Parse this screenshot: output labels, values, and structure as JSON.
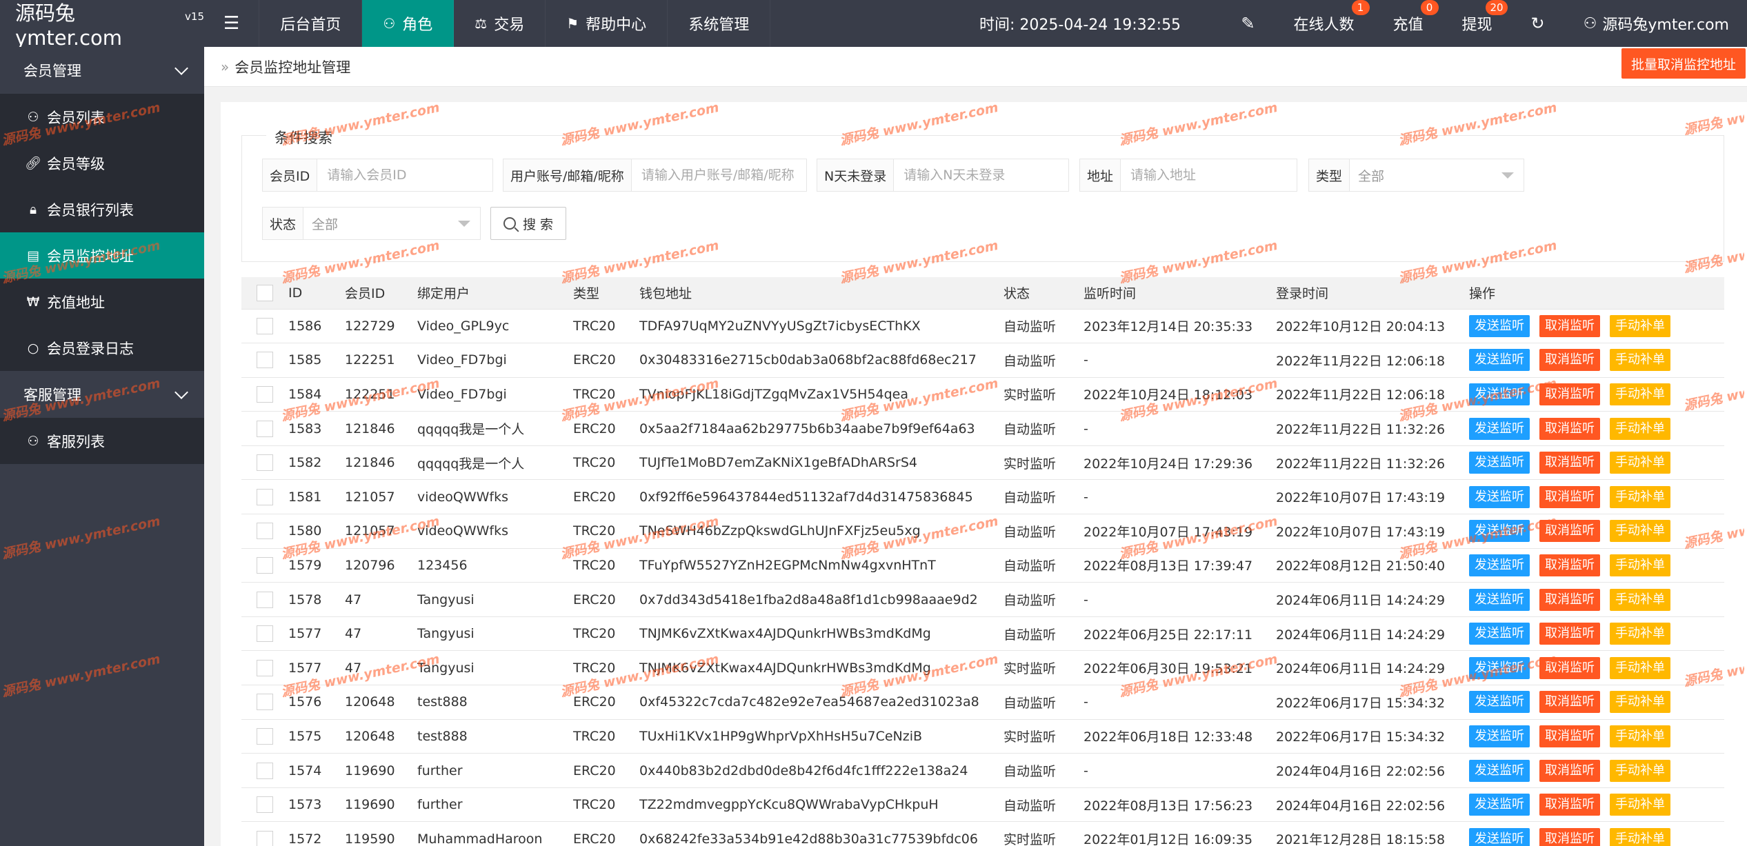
{
  "app": {
    "logo": "源码兔ymter.com",
    "version": "v15"
  },
  "topnav": {
    "items": [
      {
        "label": "后台首页"
      },
      {
        "label": "角色"
      },
      {
        "label": "交易"
      },
      {
        "label": "帮助中心"
      },
      {
        "label": "系统管理"
      }
    ],
    "time": "时间: 2025-04-24 19:32:55",
    "online": {
      "label": "在线人数",
      "badge": "1"
    },
    "recharge": {
      "label": "充值",
      "badge": "0"
    },
    "withdraw": {
      "label": "提现",
      "badge": "20"
    },
    "user": "源码兔ymter.com"
  },
  "sidebar": {
    "group1": "会员管理",
    "items1": [
      {
        "label": "会员列表"
      },
      {
        "label": "会员等级"
      },
      {
        "label": "会员银行列表"
      },
      {
        "label": "会员监控地址"
      },
      {
        "label": "充值地址"
      },
      {
        "label": "会员登录日志"
      }
    ],
    "group2": "客服管理",
    "items2": [
      {
        "label": "客服列表"
      }
    ]
  },
  "page": {
    "breadcrumb": "会员监控地址管理",
    "batch_button": "批量取消监控地址"
  },
  "search": {
    "legend": "条件搜索",
    "member_id_label": "会员ID",
    "member_id_placeholder": "请输入会员ID",
    "account_label": "用户账号/邮箱/昵称",
    "account_placeholder": "请输入用户账号/邮箱/昵称",
    "days_label": "N天未登录",
    "days_placeholder": "请输入N天未登录",
    "address_label": "地址",
    "address_placeholder": "请输入地址",
    "type_label": "类型",
    "type_value": "全部",
    "status_label": "状态",
    "status_value": "全部",
    "search_button": "搜 索"
  },
  "table": {
    "headers": [
      "ID",
      "会员ID",
      "绑定用户",
      "类型",
      "钱包地址",
      "状态",
      "监听时间",
      "登录时间",
      "操作"
    ],
    "actions": {
      "send": "发送监听",
      "cancel": "取消监听",
      "manual": "手动补单"
    },
    "rows": [
      {
        "id": "1586",
        "member_id": "122729",
        "user": "Video_GPL9yc",
        "type": "TRC20",
        "address": "TDFA97UqMY2uZNVYyUSgZt7icbysECThKX",
        "status": "自动监听",
        "status_kind": "green",
        "listen_time": "2023年12月14日 20:35:33",
        "login_time": "2022年10月12日 20:04:13"
      },
      {
        "id": "1585",
        "member_id": "122251",
        "user": "Video_FD7bgi",
        "type": "ERC20",
        "address": "0x30483316e2715cb0dab3a068bf2ac88fd68ec217",
        "status": "自动监听",
        "status_kind": "blue",
        "listen_time": "-",
        "login_time": "2022年11月22日 12:06:18"
      },
      {
        "id": "1584",
        "member_id": "122251",
        "user": "Video_FD7bgi",
        "type": "TRC20",
        "address": "TVniopFJKL18iGdjTZgqMvZax1V5H54qea",
        "status": "实时监听",
        "status_kind": "darkblue",
        "listen_time": "2022年10月24日 18:12:03",
        "login_time": "2022年11月22日 12:06:18"
      },
      {
        "id": "1583",
        "member_id": "121846",
        "user": "qqqqq我是一个人",
        "type": "ERC20",
        "address": "0x5aa2f7184aa62b29775b6b34aabe7b9f9ef64a63",
        "status": "自动监听",
        "status_kind": "blue",
        "listen_time": "-",
        "login_time": "2022年11月22日 11:32:26"
      },
      {
        "id": "1582",
        "member_id": "121846",
        "user": "qqqqq我是一个人",
        "type": "TRC20",
        "address": "TUJfTe1MoBD7emZaKNiX1geBfADhARSrS4",
        "status": "实时监听",
        "status_kind": "darkblue",
        "listen_time": "2022年10月24日 17:29:36",
        "login_time": "2022年11月22日 11:32:26"
      },
      {
        "id": "1581",
        "member_id": "121057",
        "user": "videoQWWfks",
        "type": "ERC20",
        "address": "0xf92ff6e596437844ed51132af7d4d31475836845",
        "status": "自动监听",
        "status_kind": "blue",
        "listen_time": "-",
        "login_time": "2022年10月07日 17:43:19"
      },
      {
        "id": "1580",
        "member_id": "121057",
        "user": "videoQWWfks",
        "type": "TRC20",
        "address": "TNeSWH46bZzpQkswdGLhUJnFXFjz5eu5xg",
        "status": "自动监听",
        "status_kind": "green",
        "listen_time": "2022年10月07日 17:43:19",
        "login_time": "2022年10月07日 17:43:19"
      },
      {
        "id": "1579",
        "member_id": "120796",
        "user": "123456",
        "type": "TRC20",
        "address": "TFuYpfW5527YZnH2EGPMcNmNw4gxvnHTnT",
        "status": "自动监听",
        "status_kind": "green",
        "listen_time": "2022年08月13日 17:39:47",
        "login_time": "2022年08月12日 21:50:40"
      },
      {
        "id": "1578",
        "member_id": "47",
        "user": "Tangyusi",
        "type": "ERC20",
        "address": "0x7dd343d5418e1fba2d8a48a8f1d1cb998aaae9d2",
        "status": "自动监听",
        "status_kind": "blue",
        "listen_time": "-",
        "login_time": "2024年06月11日 14:24:29"
      },
      {
        "id": "1577",
        "member_id": "47",
        "user": "Tangyusi",
        "type": "TRC20",
        "address": "TNJMK6vZXtKwax4AJDQunkrHWBs3mdKdMg",
        "status": "自动监听",
        "status_kind": "green",
        "listen_time": "2022年06月25日 22:17:11",
        "login_time": "2024年06月11日 14:24:29"
      },
      {
        "id": "1577",
        "member_id": "47",
        "user": "Tangyusi",
        "type": "TRC20",
        "address": "TNJMK6vZXtKwax4AJDQunkrHWBs3mdKdMg",
        "status": "实时监听",
        "status_kind": "darkblue",
        "listen_time": "2022年06月30日 19:53:21",
        "login_time": "2024年06月11日 14:24:29"
      },
      {
        "id": "1576",
        "member_id": "120648",
        "user": "test888",
        "type": "ERC20",
        "address": "0xf45322c7cda7c482e92e7ea54687ea2ed31023a8",
        "status": "自动监听",
        "status_kind": "blue",
        "listen_time": "-",
        "login_time": "2022年06月17日 15:34:32"
      },
      {
        "id": "1575",
        "member_id": "120648",
        "user": "test888",
        "type": "TRC20",
        "address": "TUxHi1KVx1HP9gWhprVpXhHsH5u7CeNziB",
        "status": "实时监听",
        "status_kind": "darkblue",
        "listen_time": "2022年06月18日 12:33:48",
        "login_time": "2022年06月17日 15:34:32"
      },
      {
        "id": "1574",
        "member_id": "119690",
        "user": "further",
        "type": "ERC20",
        "address": "0x440b83b2d2dbd0de8b42f6d4fc1fff222e138a24",
        "status": "自动监听",
        "status_kind": "blue",
        "listen_time": "-",
        "login_time": "2024年04月16日 22:02:56"
      },
      {
        "id": "1573",
        "member_id": "119690",
        "user": "further",
        "type": "TRC20",
        "address": "TZ22mdmvegppYcKcu8QWWrabaVypCHkpuH",
        "status": "自动监听",
        "status_kind": "green",
        "listen_time": "2022年08月13日 17:56:23",
        "login_time": "2024年04月16日 22:02:56"
      },
      {
        "id": "1572",
        "member_id": "119590",
        "user": "MuhammadHaroon",
        "type": "ERC20",
        "address": "0x68242fe33a534b91e42d88b30a31c77539bfdc06",
        "status": "实时监听",
        "status_kind": "darkblue",
        "listen_time": "2022年01月12日 16:09:35",
        "login_time": "2021年12月28日 18:15:58"
      }
    ]
  },
  "watermark": "源码兔 www.ymter.com"
}
